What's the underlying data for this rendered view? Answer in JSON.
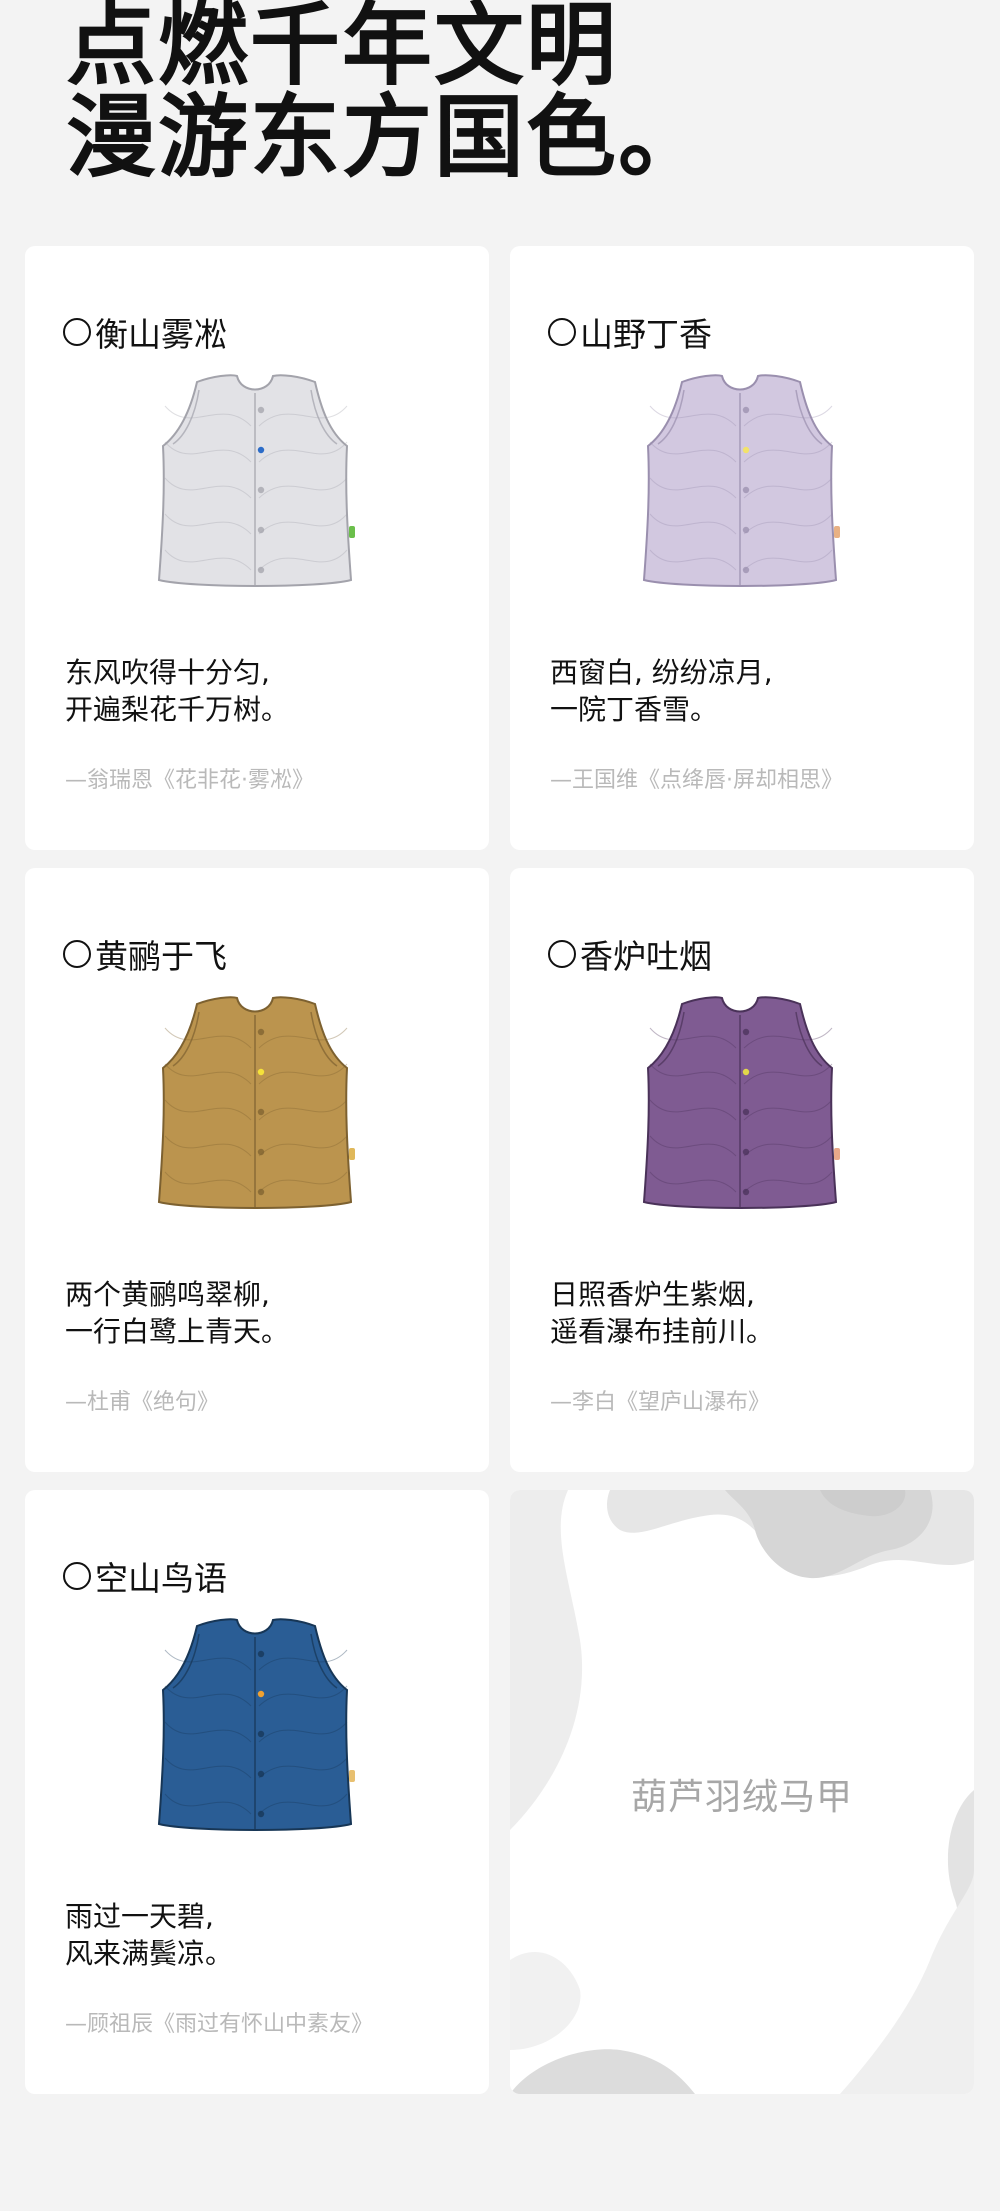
{
  "headline": {
    "line1": "点燃千年文明",
    "line2": "漫游东方国色。"
  },
  "cards": [
    {
      "title": "衡山雾凇",
      "poem1": "东风吹得十分匀,",
      "poem2": "开遍梨花千万树。",
      "source": "—翁瑞恩《花非花·雾凇》",
      "vest_color": "#e2e2e6",
      "outline": "#a3a3ab",
      "button_color": "#2c6cc8",
      "tag_color": "#6bbf4b"
    },
    {
      "title": "山野丁香",
      "poem1": "西窗白, 纷纷凉月,",
      "poem2": "一院丁香雪。",
      "source": "—王国维《点绛唇·屏却相思》",
      "vest_color": "#d2c8e0",
      "outline": "#9a8fae",
      "button_color": "#f2e26a",
      "tag_color": "#e8b184"
    },
    {
      "title": "黄鹂于飞",
      "poem1": "两个黄鹂鸣翠柳,",
      "poem2": "一行白鹭上青天。",
      "source": "—杜甫《绝句》",
      "vest_color": "#bb944e",
      "outline": "#7d6130",
      "button_color": "#f5e23a",
      "tag_color": "#e0b85a"
    },
    {
      "title": "香炉吐烟",
      "poem1": "日照香炉生紫烟,",
      "poem2": "遥看瀑布挂前川。",
      "source": "—李白《望庐山瀑布》",
      "vest_color": "#7f5b92",
      "outline": "#4a3259",
      "button_color": "#e2d84a",
      "tag_color": "#e8a88a"
    },
    {
      "title": "空山鸟语",
      "poem1": "雨过一天碧,",
      "poem2": "风来满鬓凉。",
      "source": "—顾祖辰《雨过有怀山中素友》",
      "vest_color": "#2a5d95",
      "outline": "#173656",
      "button_color": "#f0a130",
      "tag_color": "#e8c070"
    }
  ],
  "promo": {
    "label": "葫芦羽绒马甲"
  }
}
